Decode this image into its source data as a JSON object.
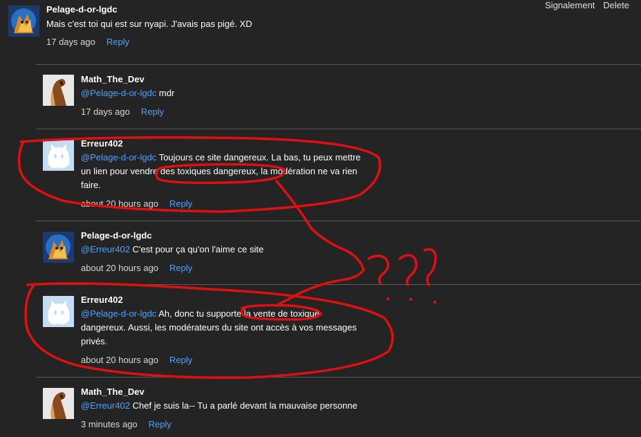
{
  "top_actions": {
    "report": "Signalement",
    "delete": "Delete"
  },
  "comments": [
    {
      "username": "Pelage-d-or-lgdc",
      "avatar": "flame-cat-avatar",
      "mention": "",
      "text": "Mais c'est toi qui est sur nyapi. J'avais pas pigé. XD",
      "time": "17 days ago",
      "reply": "Reply"
    },
    {
      "username": "Math_The_Dev",
      "avatar": "horse-avatar",
      "mention": "@Pelage-d-or-lgdc",
      "text": " mdr",
      "time": "17 days ago",
      "reply": "Reply"
    },
    {
      "username": "Erreur402",
      "avatar": "ghost-cat-avatar",
      "mention": "@Pelage-d-or-lgdc",
      "text": " Toujours ce site dangereux. La bas, tu peux mettre un lien pour vendre des toxiques dangereux, la modération ne va rien faire.",
      "time": "about 20 hours ago",
      "reply": "Reply"
    },
    {
      "username": "Pelage-d-or-lgdc",
      "avatar": "flame-cat-avatar",
      "mention": "@Erreur402",
      "text": " C'est pour ça qu'on l'aime ce site",
      "time": "about 20 hours ago",
      "reply": "Reply"
    },
    {
      "username": "Erreur402",
      "avatar": "ghost-cat-avatar",
      "mention": "@Pelage-d-or-lgdc",
      "text": " Ah, donc tu supporte la vente de toxique dangereux. Aussi, les modérateurs du site ont accès à vos messages privés.",
      "time": "about 20 hours ago",
      "reply": "Reply"
    },
    {
      "username": "Math_The_Dev",
      "avatar": "horse-avatar",
      "mention": "@Erreur402",
      "text": " Chef je suis la-- Tu a parlé devant la mauvaise personne",
      "time": "3 minutes ago",
      "reply": "Reply"
    }
  ],
  "colors": {
    "background": "#242424",
    "link": "#4da3ff",
    "annotation": "#e01010"
  }
}
